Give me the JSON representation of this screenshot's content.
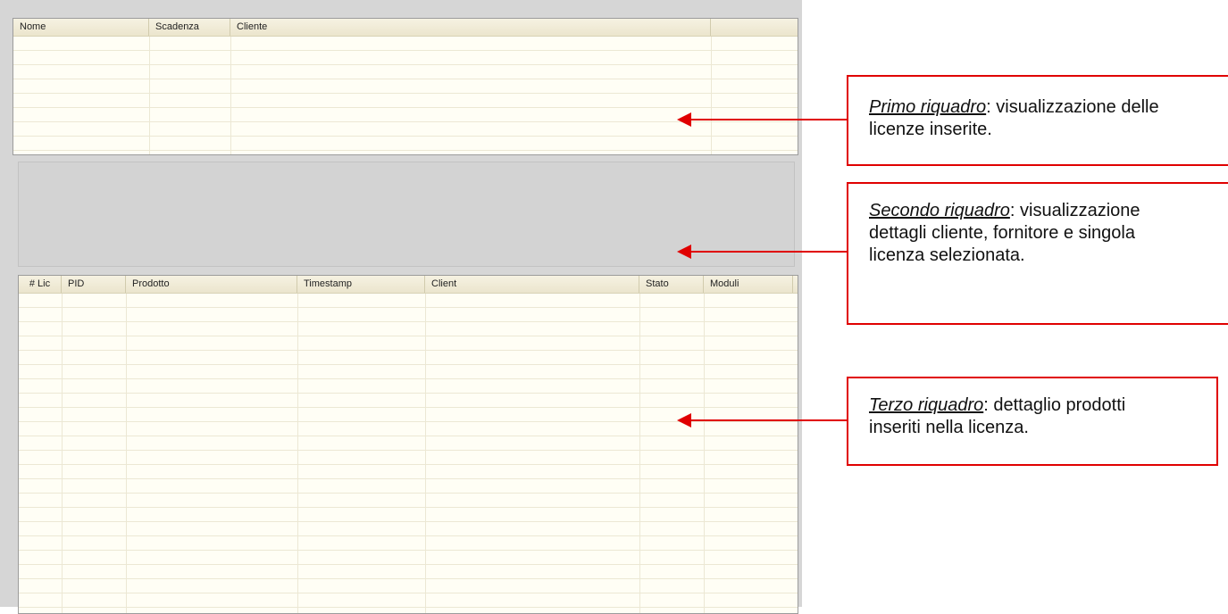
{
  "panel1": {
    "columns": [
      "Nome",
      "Scadenza",
      "Cliente",
      ""
    ]
  },
  "panel3": {
    "columns": [
      "# Lic",
      "PID",
      "Prodotto",
      "Timestamp",
      "Client",
      "Stato",
      "Moduli"
    ]
  },
  "callouts": [
    {
      "title": "Primo riquadro",
      "text": ": visualizzazione delle licenze inserite."
    },
    {
      "title": "Secondo riquadro",
      "text": ": visualizzazione dettagli cliente, fornitore e singola licenza selezionata."
    },
    {
      "title": "Terzo riquadro",
      "text": ": dettaglio prodotti inseriti nella licenza."
    }
  ],
  "colors": {
    "accent": "#e00000",
    "grid_header": "#ebe5cd",
    "grid_body": "#fffef5",
    "panel_gray": "#d3d3d3"
  }
}
